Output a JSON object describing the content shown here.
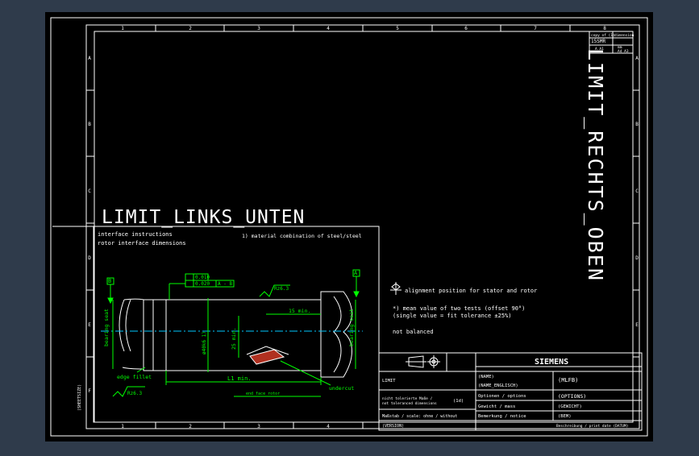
{
  "colors": {
    "viewport_bg": "#2f3b4b",
    "paper": "#000000",
    "line": "#ffffff",
    "green": "#00ff00",
    "cyan": "#00c8ff",
    "red": "#ff3030",
    "hatch": "#b03020"
  },
  "frame": {
    "columns": [
      "1",
      "2",
      "3",
      "4",
      "5",
      "6",
      "7",
      "8"
    ],
    "rows": [
      "A",
      "B",
      "C",
      "D",
      "E",
      "F"
    ]
  },
  "titles": {
    "left": "LIMIT_LINKS_UNTEN",
    "right": "LIMIT_RECHTS_OBEN",
    "side_stamp": "(SHEETSIZE)"
  },
  "top_right_block": {
    "c1": "copy of (1)",
    "c2": "dimension",
    "c3": "15SMR",
    "c4": "A A1",
    "c5": "mm",
    "c6": "A4 A3"
  },
  "interface": {
    "line1": "interface instructions",
    "line2": "rotor interface dimensions",
    "material": "1) material combination of steel/steel",
    "datum_b": "B",
    "datum_a": "A",
    "tol1": "0.010",
    "tol2": "0.020",
    "tol2_ref": "A - B",
    "roughness_top": "Rz6.3",
    "roughness_bottom": "Rz6.3",
    "bearing_left": "bearing seat",
    "bearing_right": "bearing seat",
    "dim_15": "15 min.",
    "dim_25": "25 min.",
    "dim_l1": "L1 min.",
    "dim_phi": "ø40k6 1)",
    "edge_fillet": "edge fillet",
    "end_face": "end face rotor",
    "undercut": "undercut"
  },
  "notes": {
    "alignment": "alignment position for stator and rotor",
    "mean": "*) mean value of two tests (offset 90°)",
    "single": "(single value = fit tolerance ±25%)",
    "balanced": "not balanced"
  },
  "title_block": {
    "brand": "SIEMENS",
    "limits": "LIMIT",
    "name": "(NAME)",
    "name_en": "(NAME_ENGLISCH)",
    "mlfb": "(MLFB)",
    "tol_label": "nicht tolerierte Maße /",
    "tol_label2": "not toleranced dimensions",
    "tol_value": "(1d)",
    "options_label": "Optionen / options",
    "options_value": "(OPTIONS)",
    "weight_label": "Gewicht / mass",
    "weight_value": "(GEWICHT)",
    "remark_label": "Bemerkung / notice",
    "remark_value": "(BEM)",
    "scale_label": "Maßstab / scale: ohne / without",
    "version": "(VERSION)",
    "description": "Beschreibung / print date (DATUM)"
  }
}
